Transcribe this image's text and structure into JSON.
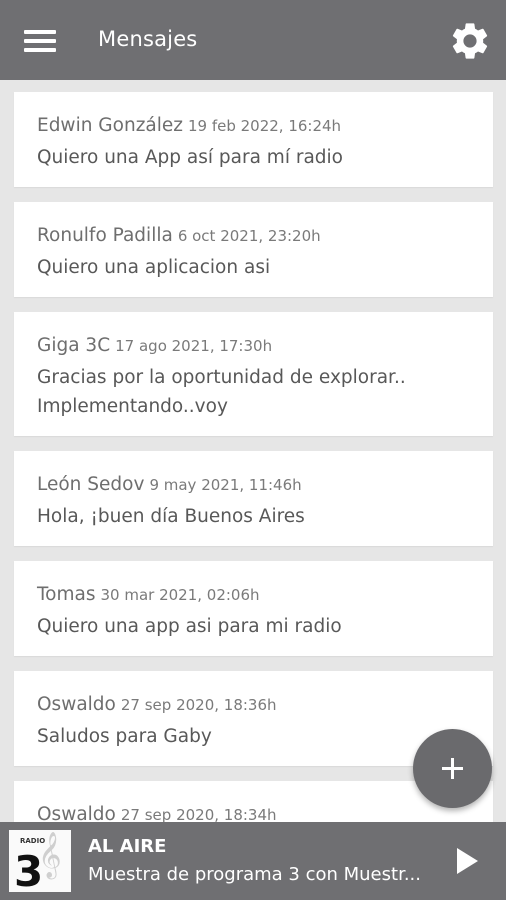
{
  "header": {
    "title": "Mensajes",
    "menu_icon": "hamburger-menu-icon",
    "settings_icon": "gear-icon"
  },
  "messages": [
    {
      "author": "Edwin González",
      "date": "19 feb 2022, 16:24h",
      "text": "Quiero una App así para mí radio"
    },
    {
      "author": "Ronulfo Padilla",
      "date": "6 oct 2021, 23:20h",
      "text": "Quiero una aplicacion asi"
    },
    {
      "author": "Giga 3C",
      "date": "17 ago 2021, 17:30h",
      "text_line1": "Gracias por la oportunidad de explorar..",
      "text_line2": "Implementando..voy"
    },
    {
      "author": "León Sedov",
      "date": "9 may 2021, 11:46h",
      "text": "Hola, ¡buen día Buenos Aires"
    },
    {
      "author": "Tomas",
      "date": "30 mar 2021, 02:06h",
      "text": "Quiero una app asi para mi radio"
    },
    {
      "author": "Oswaldo",
      "date": "27 sep 2020, 18:36h",
      "text": "Saludos para Gaby"
    },
    {
      "author": "Oswaldo",
      "date": "27 sep 2020, 18:34h",
      "text": ""
    }
  ],
  "fab": {
    "icon": "plus-icon"
  },
  "player": {
    "label": "AL AIRE",
    "subtitle": "Muestra de programa 3 con Muestr...",
    "logo_text_top": "RADIO",
    "logo_text_number": "3",
    "play_icon": "play-icon"
  },
  "colors": {
    "bar": "#6f6f72",
    "background": "#e6e6e6",
    "card": "#ffffff",
    "text_primary": "#585858",
    "text_secondary": "#6e6e6e"
  }
}
